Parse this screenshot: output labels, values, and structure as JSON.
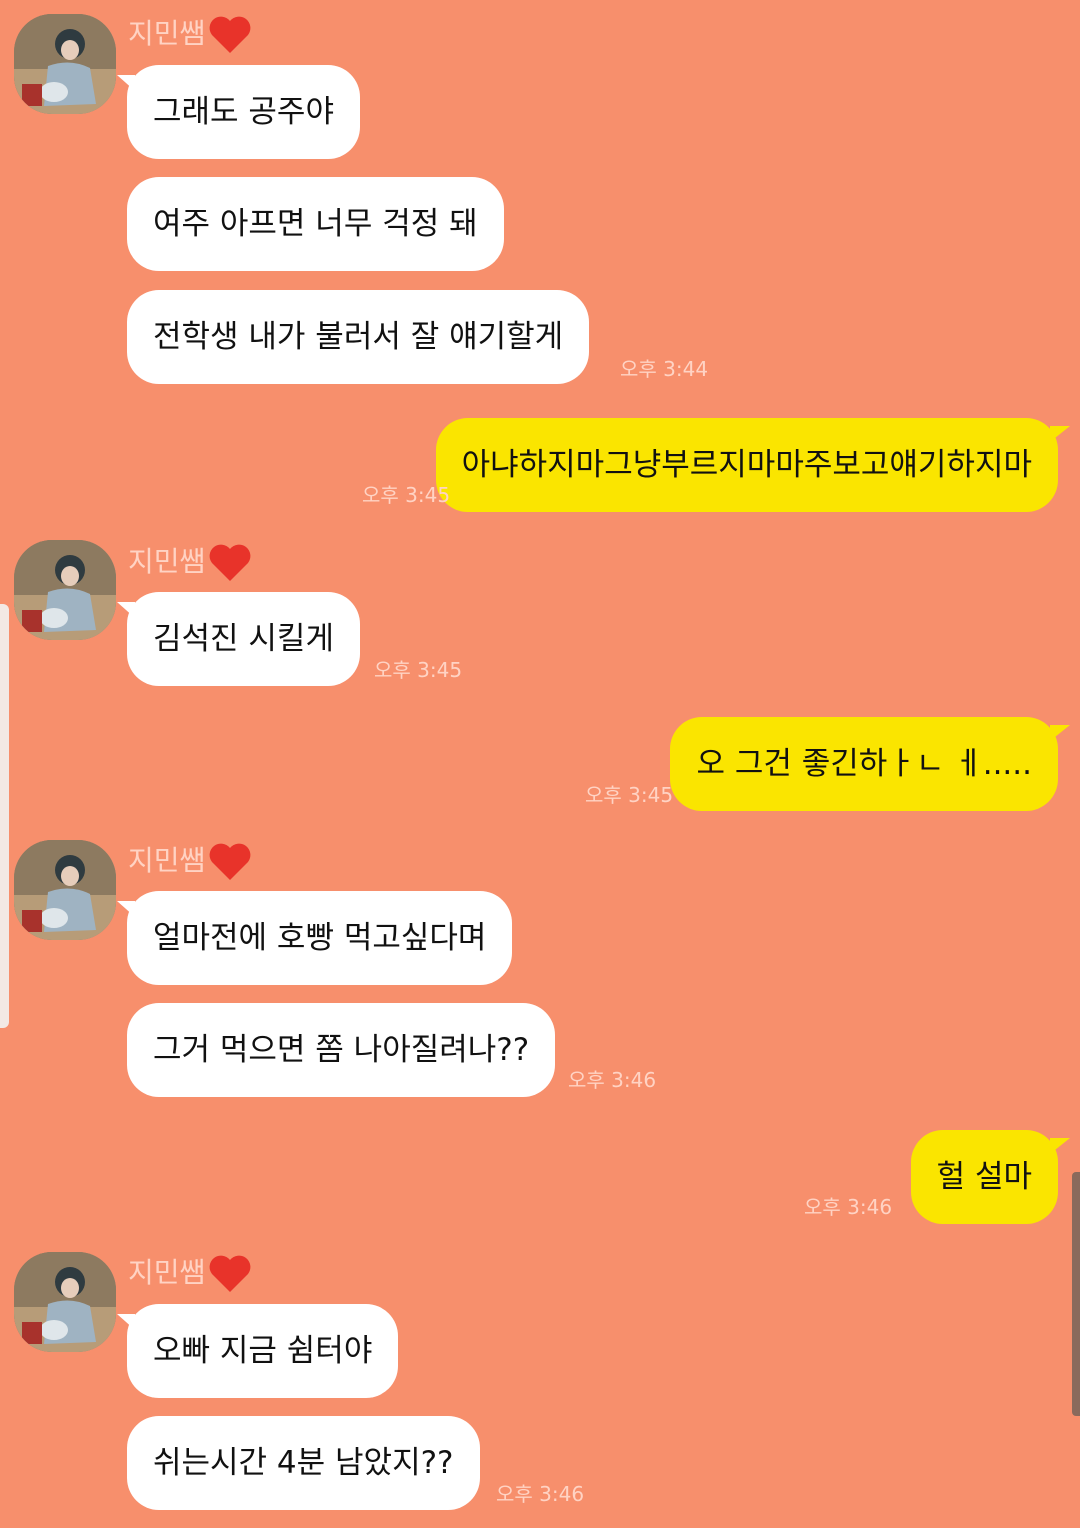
{
  "chat": {
    "sender_name": "지민쌤",
    "colors": {
      "background": "#F78F6C",
      "incoming_bubble": "#FFFFFF",
      "outgoing_bubble": "#FAE500",
      "meta_text": "#FFD3C4",
      "heart": "#E8332A"
    },
    "groups": [
      {
        "messages": [
          {
            "text": "그래도 공주야"
          },
          {
            "text": "여주 아프면 너무 걱정 돼"
          },
          {
            "text": "전학생 내가 불러서 잘 얘기할게",
            "time": "오후 3:44"
          }
        ]
      },
      {
        "outgoing": true,
        "messages": [
          {
            "text": "아냐하지마그냥부르지마마주보고얘기하지마",
            "time": "오후 3:45"
          }
        ]
      },
      {
        "messages": [
          {
            "text": "김석진 시킬게",
            "time": "오후 3:45"
          }
        ]
      },
      {
        "outgoing": true,
        "messages": [
          {
            "text": "오 그건 좋긴하ㅏㄴ ㅔ.....",
            "time": "오후 3:45"
          }
        ]
      },
      {
        "messages": [
          {
            "text": "얼마전에 호빵 먹고싶다며"
          },
          {
            "text": "그거 먹으면 쫌 나아질려나??",
            "time": "오후 3:46"
          }
        ]
      },
      {
        "outgoing": true,
        "messages": [
          {
            "text": "헐 설마",
            "time": "오후 3:46"
          }
        ]
      },
      {
        "messages": [
          {
            "text": "오빠 지금 쉼터야"
          },
          {
            "text": "쉬는시간 4분 남았지??",
            "time": "오후 3:46"
          }
        ]
      }
    ]
  }
}
